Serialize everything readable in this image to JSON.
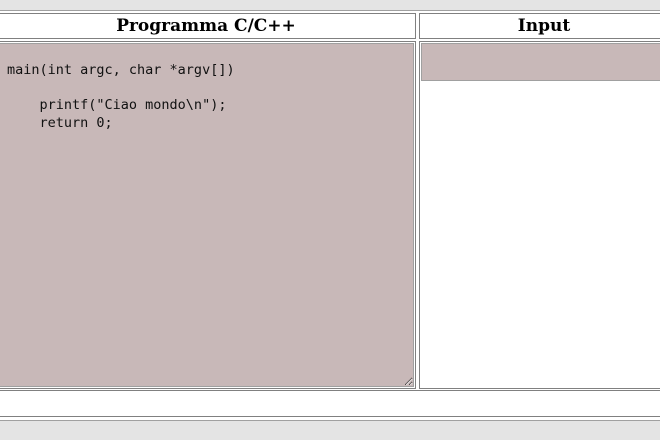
{
  "headers": {
    "program_title": "Programma C/C++",
    "input_title": "Input"
  },
  "editor": {
    "code": "main(int argc, char *argv[])\n\n    printf(\"Ciao mondo\\n\");\n    return 0;"
  },
  "input": {
    "value": ""
  }
}
